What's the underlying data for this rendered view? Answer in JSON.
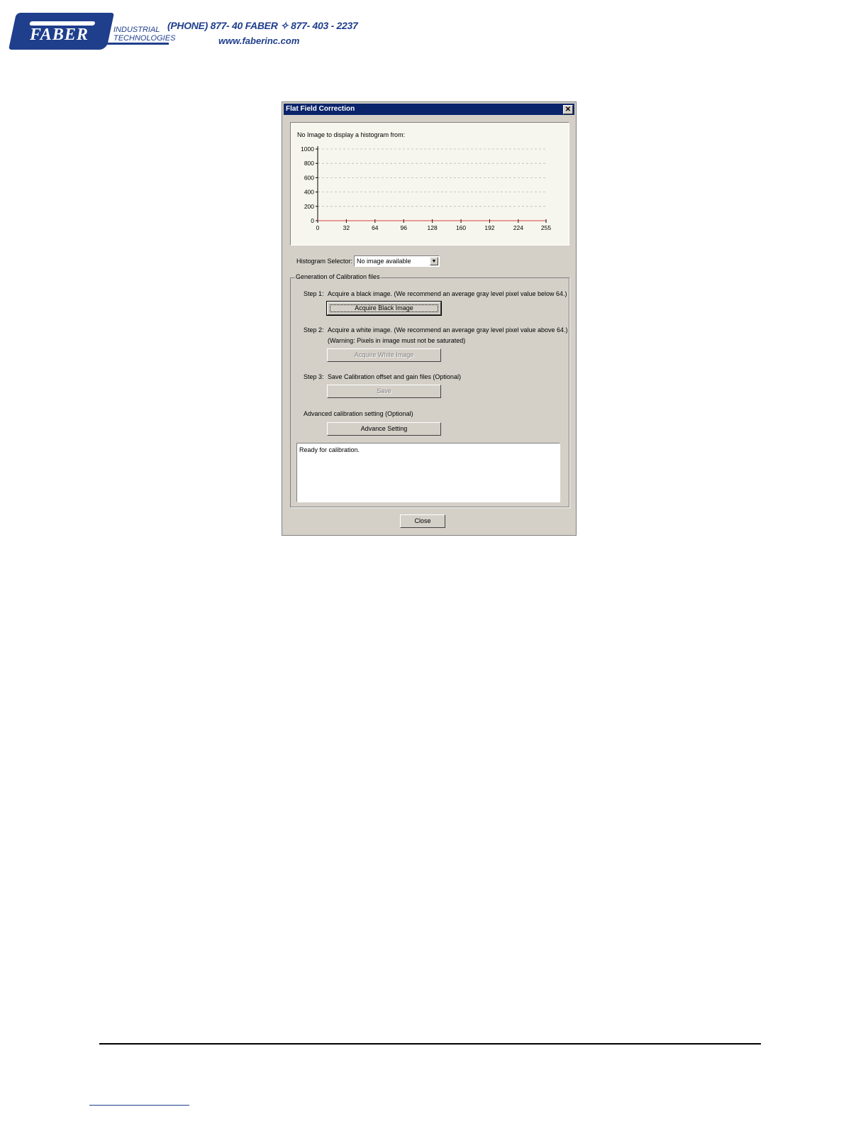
{
  "header": {
    "logo_name": "FABER",
    "logo_sub1": "INDUSTRIAL",
    "logo_sub2": "TECHNOLOGIES",
    "phone": "(PHONE) 877- 40 FABER ✧ 877- 403 - 2237",
    "website": "www.faberinc.com",
    "brand_color": "#1f3e8c"
  },
  "dialog": {
    "title": "Flat Field Correction",
    "close_glyph": "✕",
    "histogram_message": "No Image to display a histogram from:",
    "histogram_selector_label": "Histogram Selector:",
    "histogram_selector_value": "No image available",
    "group_title": "Generation of Calibration files",
    "step1_label": "Step 1:",
    "step1_text": "Acquire a black image. (We recommend an average gray level pixel value below 64.)",
    "step1_button": "Acquire Black Image",
    "step2_label": "Step 2:",
    "step2_text": "Acquire a white image. (We recommend an average gray level pixel value above 64.)",
    "step2_warning": "(Warning: Pixels in image must not be saturated)",
    "step2_button": "Acquire White Image",
    "step3_label": "Step 3:",
    "step3_text": "Save Calibration offset and gain files (Optional)",
    "step3_button": "Save",
    "advanced_text": "Advanced calibration setting (Optional)",
    "advanced_button": "Advance Setting",
    "status_text": "Ready for calibration.",
    "close_button": "Close",
    "titlebar_color": "#0a246a"
  },
  "chart_data": {
    "type": "line",
    "title": "",
    "xlabel": "",
    "ylabel": "",
    "x_ticks": [
      0,
      32,
      64,
      96,
      128,
      160,
      192,
      224,
      255
    ],
    "y_ticks": [
      0,
      200,
      400,
      600,
      800,
      1000
    ],
    "xlim": [
      0,
      255
    ],
    "ylim": [
      0,
      1000
    ],
    "grid": true,
    "series": [
      {
        "color": "#d04040",
        "x": [
          0,
          255
        ],
        "y": [
          0,
          0
        ]
      }
    ]
  }
}
